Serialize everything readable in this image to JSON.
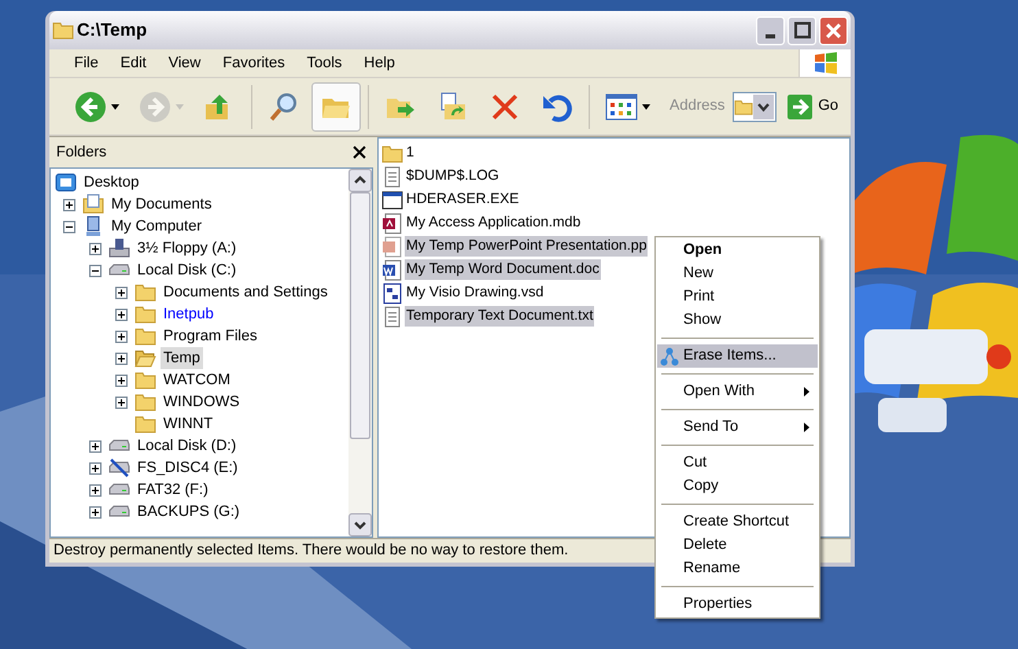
{
  "window": {
    "title": "C:\\Temp"
  },
  "menu_bar": [
    "File",
    "Edit",
    "View",
    "Favorites",
    "Tools",
    "Help"
  ],
  "toolbar": [
    {
      "kind": "back",
      "disabled": false,
      "pressed": false,
      "dropdown": true
    },
    {
      "kind": "forward",
      "disabled": true,
      "pressed": false,
      "dropdown": true
    },
    {
      "kind": "up",
      "disabled": false,
      "pressed": false,
      "dropdown": false
    },
    {
      "kind": "search",
      "disabled": false,
      "pressed": false,
      "dropdown": false
    },
    {
      "kind": "folders",
      "disabled": false,
      "pressed": true,
      "dropdown": false
    },
    {
      "kind": "move-to",
      "disabled": false,
      "pressed": false,
      "dropdown": false
    },
    {
      "kind": "copy-to",
      "disabled": false,
      "pressed": false,
      "dropdown": false
    },
    {
      "kind": "delete",
      "disabled": false,
      "pressed": false,
      "dropdown": false
    },
    {
      "kind": "undo",
      "disabled": false,
      "pressed": false,
      "dropdown": false
    },
    {
      "kind": "views",
      "disabled": false,
      "pressed": false,
      "dropdown": true
    }
  ],
  "address": {
    "label": "Address",
    "go": "Go"
  },
  "folders_pane": {
    "title": "Folders",
    "tree": [
      {
        "label": "Desktop",
        "kind": "desktop",
        "has_children": false,
        "selected": false,
        "color": "#000000",
        "children": [
          {
            "label": "My Documents",
            "kind": "documents",
            "has_children": true,
            "expanded": false,
            "selected": false,
            "color": "#000000"
          },
          {
            "label": "My Computer",
            "kind": "computer",
            "has_children": true,
            "expanded": true,
            "selected": false,
            "color": "#000000",
            "children": [
              {
                "label": "3½ Floppy (A:)",
                "kind": "floppy",
                "has_children": true,
                "expanded": false,
                "selected": false,
                "color": "#000000"
              },
              {
                "label": "Local Disk (C:)",
                "kind": "drive",
                "has_children": true,
                "expanded": true,
                "selected": false,
                "color": "#000000",
                "children": [
                  {
                    "label": "Documents and Settings",
                    "kind": "folder",
                    "has_children": true,
                    "expanded": false,
                    "selected": false,
                    "color": "#000000"
                  },
                  {
                    "label": "Inetpub",
                    "kind": "folder",
                    "has_children": true,
                    "expanded": false,
                    "selected": false,
                    "color": "#0000ff"
                  },
                  {
                    "label": "Program Files",
                    "kind": "folder",
                    "has_children": true,
                    "expanded": false,
                    "selected": false,
                    "color": "#000000"
                  },
                  {
                    "label": "Temp",
                    "kind": "folder-open",
                    "has_children": true,
                    "expanded": false,
                    "selected": true,
                    "color": "#000000"
                  },
                  {
                    "label": "WATCOM",
                    "kind": "folder",
                    "has_children": true,
                    "expanded": false,
                    "selected": false,
                    "color": "#000000"
                  },
                  {
                    "label": "WINDOWS",
                    "kind": "folder",
                    "has_children": true,
                    "expanded": false,
                    "selected": false,
                    "color": "#000000"
                  },
                  {
                    "label": "WINNT",
                    "kind": "folder",
                    "has_children": false,
                    "selected": false,
                    "color": "#000000"
                  }
                ]
              },
              {
                "label": "Local Disk (D:)",
                "kind": "drive",
                "has_children": true,
                "expanded": false,
                "selected": false,
                "color": "#000000"
              },
              {
                "label": "FS_DISC4 (E:)",
                "kind": "netdrive",
                "has_children": true,
                "expanded": false,
                "selected": false,
                "color": "#000000"
              },
              {
                "label": "FAT32 (F:)",
                "kind": "drive",
                "has_children": true,
                "expanded": false,
                "selected": false,
                "color": "#000000"
              },
              {
                "label": "BACKUPS (G:)",
                "kind": "drive",
                "has_children": true,
                "expanded": false,
                "selected": false,
                "color": "#000000"
              }
            ]
          }
        ]
      }
    ]
  },
  "files": [
    {
      "name": "1",
      "kind": "folder",
      "selected": false
    },
    {
      "name": "$DUMP$.LOG",
      "kind": "text",
      "selected": false
    },
    {
      "name": "HDERASER.EXE",
      "kind": "exe",
      "selected": false
    },
    {
      "name": "My Access Application.mdb",
      "kind": "access",
      "selected": false
    },
    {
      "name": "My Temp PowerPoint Presentation.pp",
      "kind": "powerpoint",
      "selected": true
    },
    {
      "name": "My Temp Word Document.doc",
      "kind": "word",
      "selected": true
    },
    {
      "name": "My Visio Drawing.vsd",
      "kind": "visio",
      "selected": false
    },
    {
      "name": "Temporary Text Document.txt",
      "kind": "text",
      "selected": true
    }
  ],
  "context_menu": [
    {
      "kind": "item",
      "label": "Open",
      "default": true,
      "selected": false,
      "submenu": false
    },
    {
      "kind": "item",
      "label": "New",
      "default": false,
      "selected": false,
      "submenu": false
    },
    {
      "kind": "item",
      "label": "Print",
      "default": false,
      "selected": false,
      "submenu": false
    },
    {
      "kind": "item",
      "label": "Show",
      "default": false,
      "selected": false,
      "submenu": false
    },
    {
      "kind": "separator"
    },
    {
      "kind": "icon-item",
      "label": "Erase Items...",
      "default": false,
      "selected": true,
      "submenu": false
    },
    {
      "kind": "separator"
    },
    {
      "kind": "item",
      "label": "Open With",
      "default": false,
      "selected": false,
      "submenu": true
    },
    {
      "kind": "separator"
    },
    {
      "kind": "item",
      "label": "Send To",
      "default": false,
      "selected": false,
      "submenu": true
    },
    {
      "kind": "separator"
    },
    {
      "kind": "item",
      "label": "Cut",
      "default": false,
      "selected": false,
      "submenu": false
    },
    {
      "kind": "item",
      "label": "Copy",
      "default": false,
      "selected": false,
      "submenu": false
    },
    {
      "kind": "separator"
    },
    {
      "kind": "item",
      "label": "Create Shortcut",
      "default": false,
      "selected": false,
      "submenu": false
    },
    {
      "kind": "item",
      "label": "Delete",
      "default": false,
      "selected": false,
      "submenu": false
    },
    {
      "kind": "item",
      "label": "Rename",
      "default": false,
      "selected": false,
      "submenu": false
    },
    {
      "kind": "separator"
    },
    {
      "kind": "item",
      "label": "Properties",
      "default": false,
      "selected": false,
      "submenu": false
    }
  ],
  "status_bar": "Destroy permanently selected Items. There would be no way to restore them."
}
